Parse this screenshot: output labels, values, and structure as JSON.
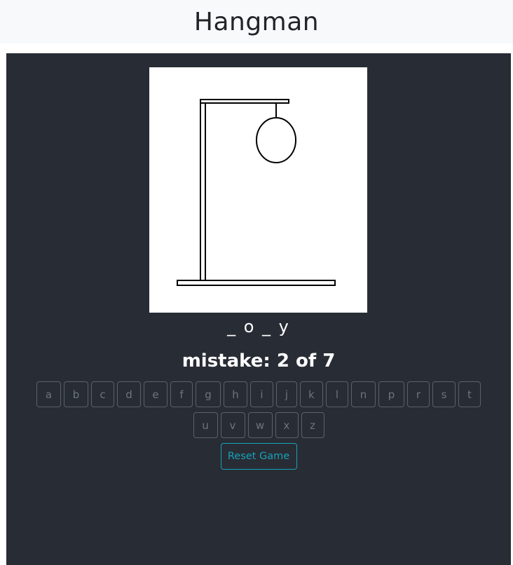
{
  "header": {
    "title": "Hangman"
  },
  "game": {
    "word_display": "_ o _ y",
    "mistake_prefix": "mistake: ",
    "mistakes": "2",
    "of_label": " of ",
    "max_mistakes": "7",
    "keyboard": {
      "row1": [
        "a",
        "b",
        "c",
        "d",
        "e",
        "f",
        "g",
        "h",
        "i",
        "j",
        "k",
        "l",
        "n",
        "p",
        "r",
        "s",
        "t"
      ],
      "row2": [
        "u",
        "v",
        "w",
        "x",
        "z"
      ]
    },
    "reset_label": "Reset Game"
  },
  "colors": {
    "panel_bg": "#282c34",
    "header_bg": "#f8f9fa",
    "reset_accent": "#17a2b8",
    "key_border": "#5b626a"
  }
}
